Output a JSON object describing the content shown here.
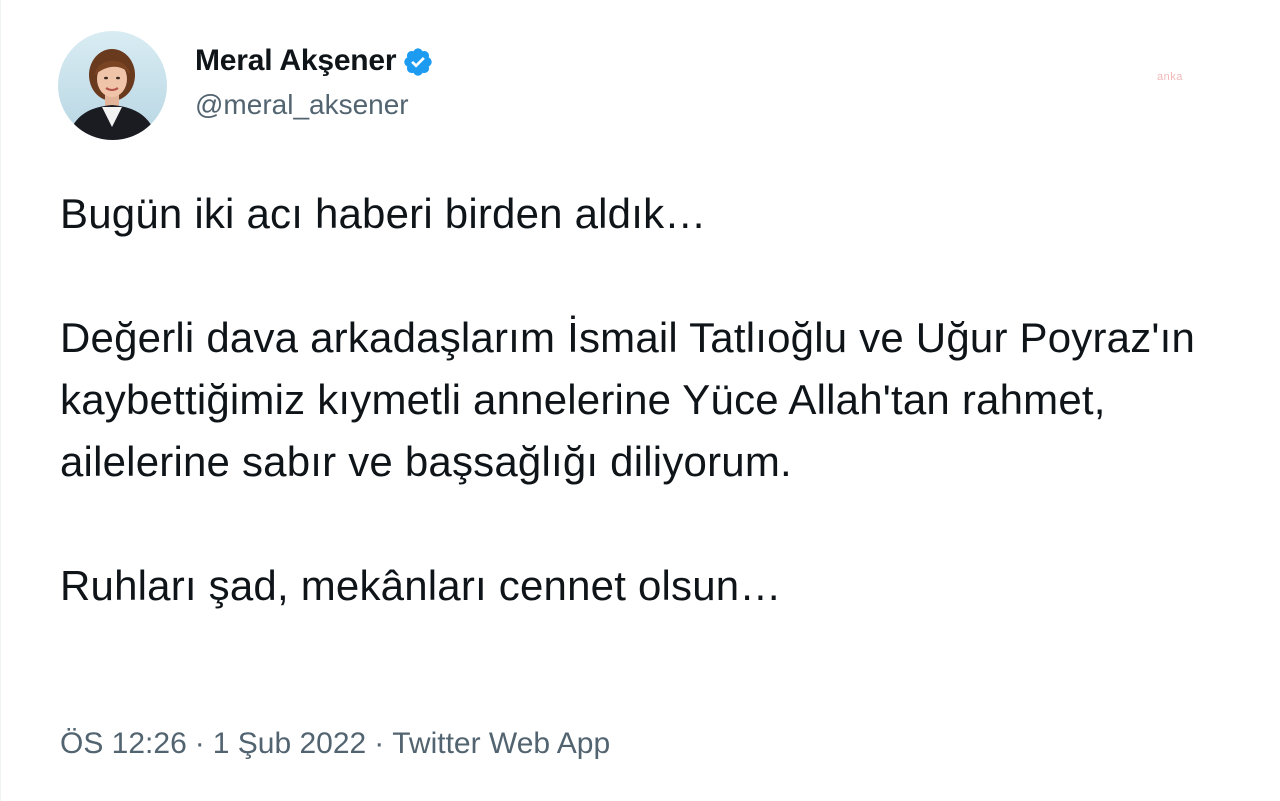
{
  "author": {
    "display_name": "Meral Akşener",
    "handle": "@meral_aksener",
    "verified_icon": "verified-badge-icon",
    "verified_color": "#1d9bf0"
  },
  "watermark": "anka",
  "tweet": {
    "paragraphs": [
      "Bugün iki acı haberi birden aldık…",
      "Değerli dava arkadaşlarım İsmail Tatlıoğlu ve Uğur Poyraz'ın kaybettiğimiz kıymetli annelerine Yüce Allah'tan rahmet, ailelerine sabır ve başsağlığı diliyorum.",
      "Ruhları şad, mekânları cennet olsun…"
    ]
  },
  "meta": {
    "time": "ÖS 12:26",
    "separator": "·",
    "date": "1 Şub 2022",
    "source": "Twitter Web App"
  },
  "colors": {
    "text": "#0f1419",
    "secondary": "#536471"
  }
}
